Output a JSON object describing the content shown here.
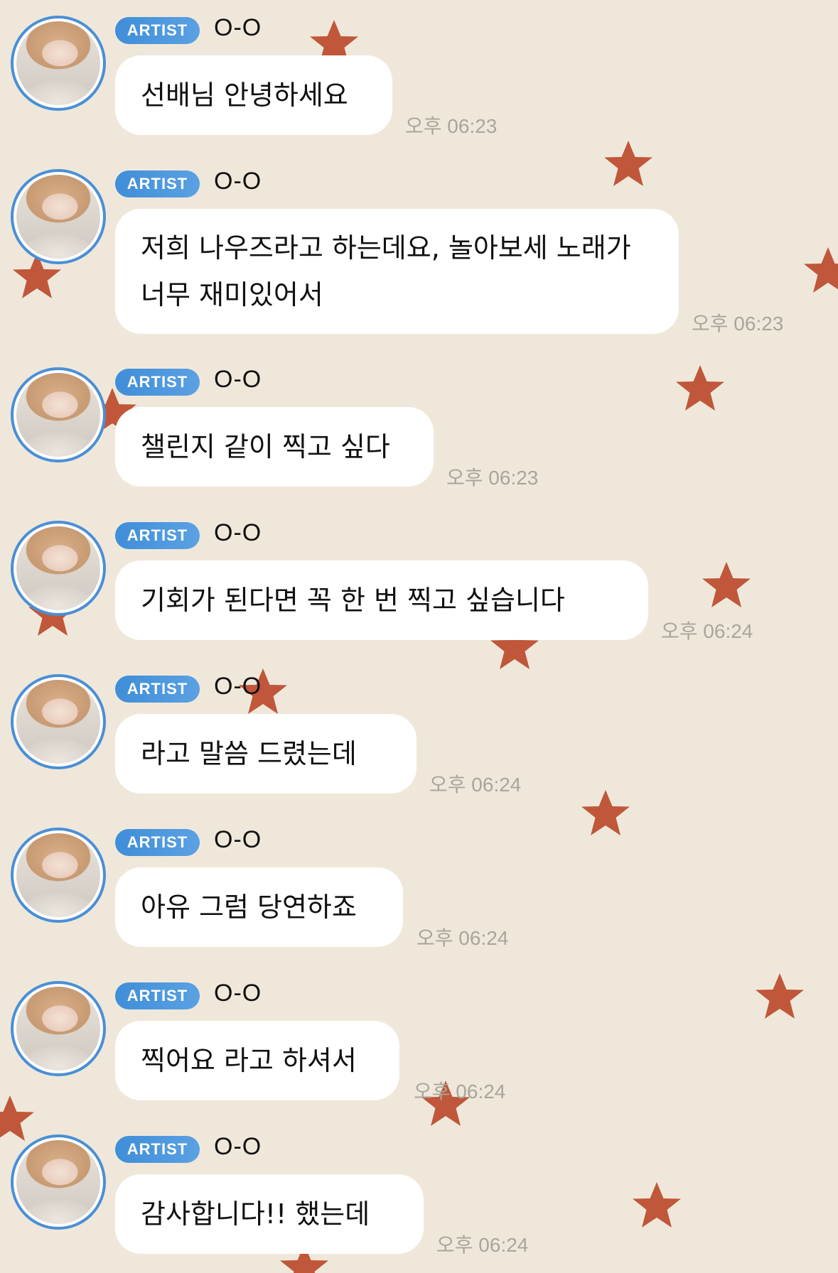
{
  "colors": {
    "background": "#efe8da",
    "star": "#c0573a",
    "badge": "#4a8fd6",
    "bubble": "#ffffff",
    "timestamp": "#a9a49c"
  },
  "messages": [
    {
      "badge": "ARTIST",
      "sender": "O-O",
      "text": "선배님 안녕하세요",
      "time": "오후 06:23"
    },
    {
      "badge": "ARTIST",
      "sender": "O-O",
      "text": "저희 나우즈라고 하는데요, 놀아보세 노래가 너무 재미있어서",
      "time": "오후 06:23"
    },
    {
      "badge": "ARTIST",
      "sender": "O-O",
      "text": "챌린지 같이 찍고 싶다",
      "time": "오후 06:23"
    },
    {
      "badge": "ARTIST",
      "sender": "O-O",
      "text": "기회가 된다면 꼭 한 번 찍고 싶습니다",
      "time": "오후 06:24"
    },
    {
      "badge": "ARTIST",
      "sender": "O-O",
      "text": "라고 말씀 드렸는데",
      "time": "오후 06:24"
    },
    {
      "badge": "ARTIST",
      "sender": "O-O",
      "text": "아유 그럼 당연하죠",
      "time": "오후 06:24"
    },
    {
      "badge": "ARTIST",
      "sender": "O-O",
      "text": "찍어요 라고 하셔서",
      "time": "오후 06:24"
    },
    {
      "badge": "ARTIST",
      "sender": "O-O",
      "text": "감사합니다!! 했는데",
      "time": "오후 06:24"
    }
  ]
}
